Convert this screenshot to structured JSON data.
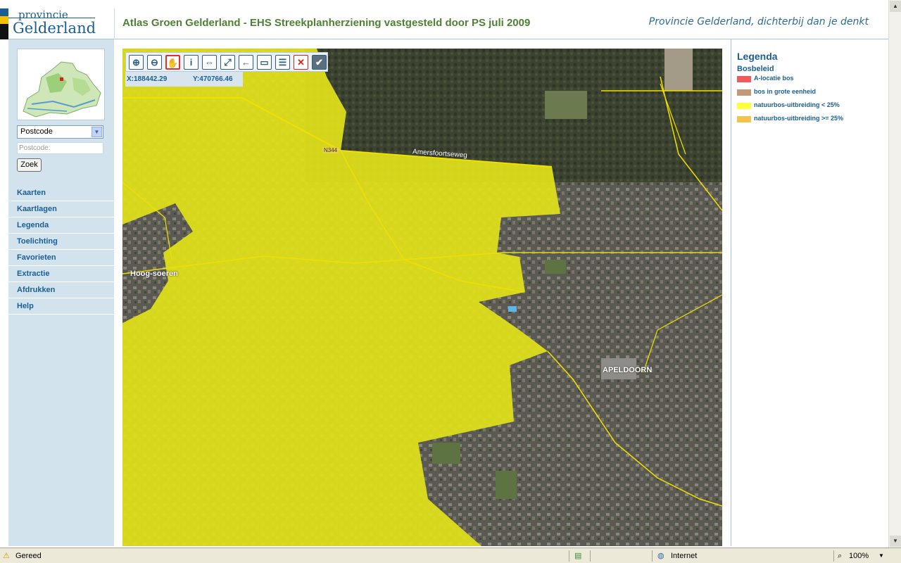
{
  "header": {
    "logo_line1": "provincie",
    "logo_line2": "Gelderland",
    "title": "Atlas Groen Gelderland - EHS Streekplanherziening vastgesteld door PS juli 2009",
    "slogan": "Provincie Gelderland, dichterbij dan je denkt"
  },
  "search": {
    "select_value": "Postcode",
    "postcode_placeholder": "Postcode:",
    "button_label": "Zoek"
  },
  "nav": {
    "items": [
      {
        "label": "Kaarten"
      },
      {
        "label": "Kaartlagen"
      },
      {
        "label": "Legenda"
      },
      {
        "label": "Toelichting"
      },
      {
        "label": "Favorieten"
      },
      {
        "label": "Extractie"
      },
      {
        "label": "Afdrukken"
      },
      {
        "label": "Help"
      }
    ]
  },
  "toolbar": {
    "tools": [
      {
        "icon": "zoom-in-icon",
        "glyph": "⊕"
      },
      {
        "icon": "zoom-out-icon",
        "glyph": "⊖"
      },
      {
        "icon": "pan-hand-icon",
        "glyph": "✋"
      },
      {
        "icon": "info-icon",
        "glyph": "i"
      },
      {
        "icon": "measure-icon",
        "glyph": "⇔"
      },
      {
        "icon": "full-extent-icon",
        "glyph": "⤢"
      },
      {
        "icon": "previous-extent-icon",
        "glyph": "←"
      },
      {
        "icon": "select-rectangle-icon",
        "glyph": "▭"
      },
      {
        "icon": "list-icon",
        "glyph": "☰"
      },
      {
        "icon": "clear-selection-icon",
        "glyph": "✕"
      },
      {
        "icon": "confirm-icon",
        "glyph": "✔"
      }
    ],
    "active_tool": "pan-hand-icon"
  },
  "coords": {
    "x": "X:188442.29",
    "y": "Y:470766.46"
  },
  "map": {
    "labels": {
      "road_number": "N344",
      "road_name": "Amersfoortseweg",
      "village": "Hoog-soeren",
      "city": "APELDOORN"
    }
  },
  "legend": {
    "title": "Legenda",
    "subtitle": "Bosbeleid",
    "entries": [
      {
        "label": "A-locatie bos",
        "color": "#f05a5a"
      },
      {
        "label": "bos in grote eenheid",
        "color": "#c29a78"
      },
      {
        "label": "natuurbos-uitbreiding < 25%",
        "color": "#ffff3c"
      },
      {
        "label": "natuurbos-uitbreiding >= 25%",
        "color": "#f5c24a"
      }
    ]
  },
  "statusbar": {
    "status": "Gereed",
    "zone": "Internet",
    "zoom": "100%"
  },
  "colors": {
    "brand_blue": "#1b5e93",
    "title_green": "#4e8232",
    "sidebar_bg": "#d2e3ee",
    "overlay_yellow": "#e6e617"
  }
}
